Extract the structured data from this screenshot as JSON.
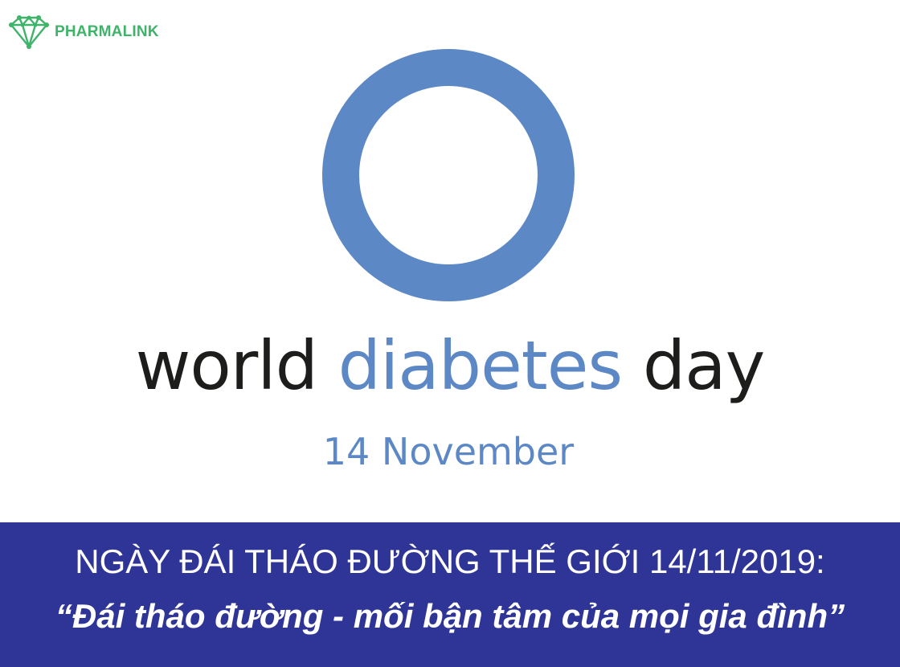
{
  "brand": {
    "name": "PHARMALINK",
    "logo_icon": "diamond-network-icon",
    "color": "#3fb36a"
  },
  "symbol": {
    "icon": "blue-circle-icon",
    "color": "#5c88c6"
  },
  "title": {
    "word1": "world",
    "word2": "diabetes",
    "word3": "day"
  },
  "date": "14 November",
  "banner": {
    "headline": "NGÀY ĐÁI THÁO ĐƯỜNG THẾ GIỚI 14/11/2019:",
    "slogan": "“Đái tháo đường - mối bận tâm của mọi gia đình”",
    "background": "#2f3597"
  }
}
